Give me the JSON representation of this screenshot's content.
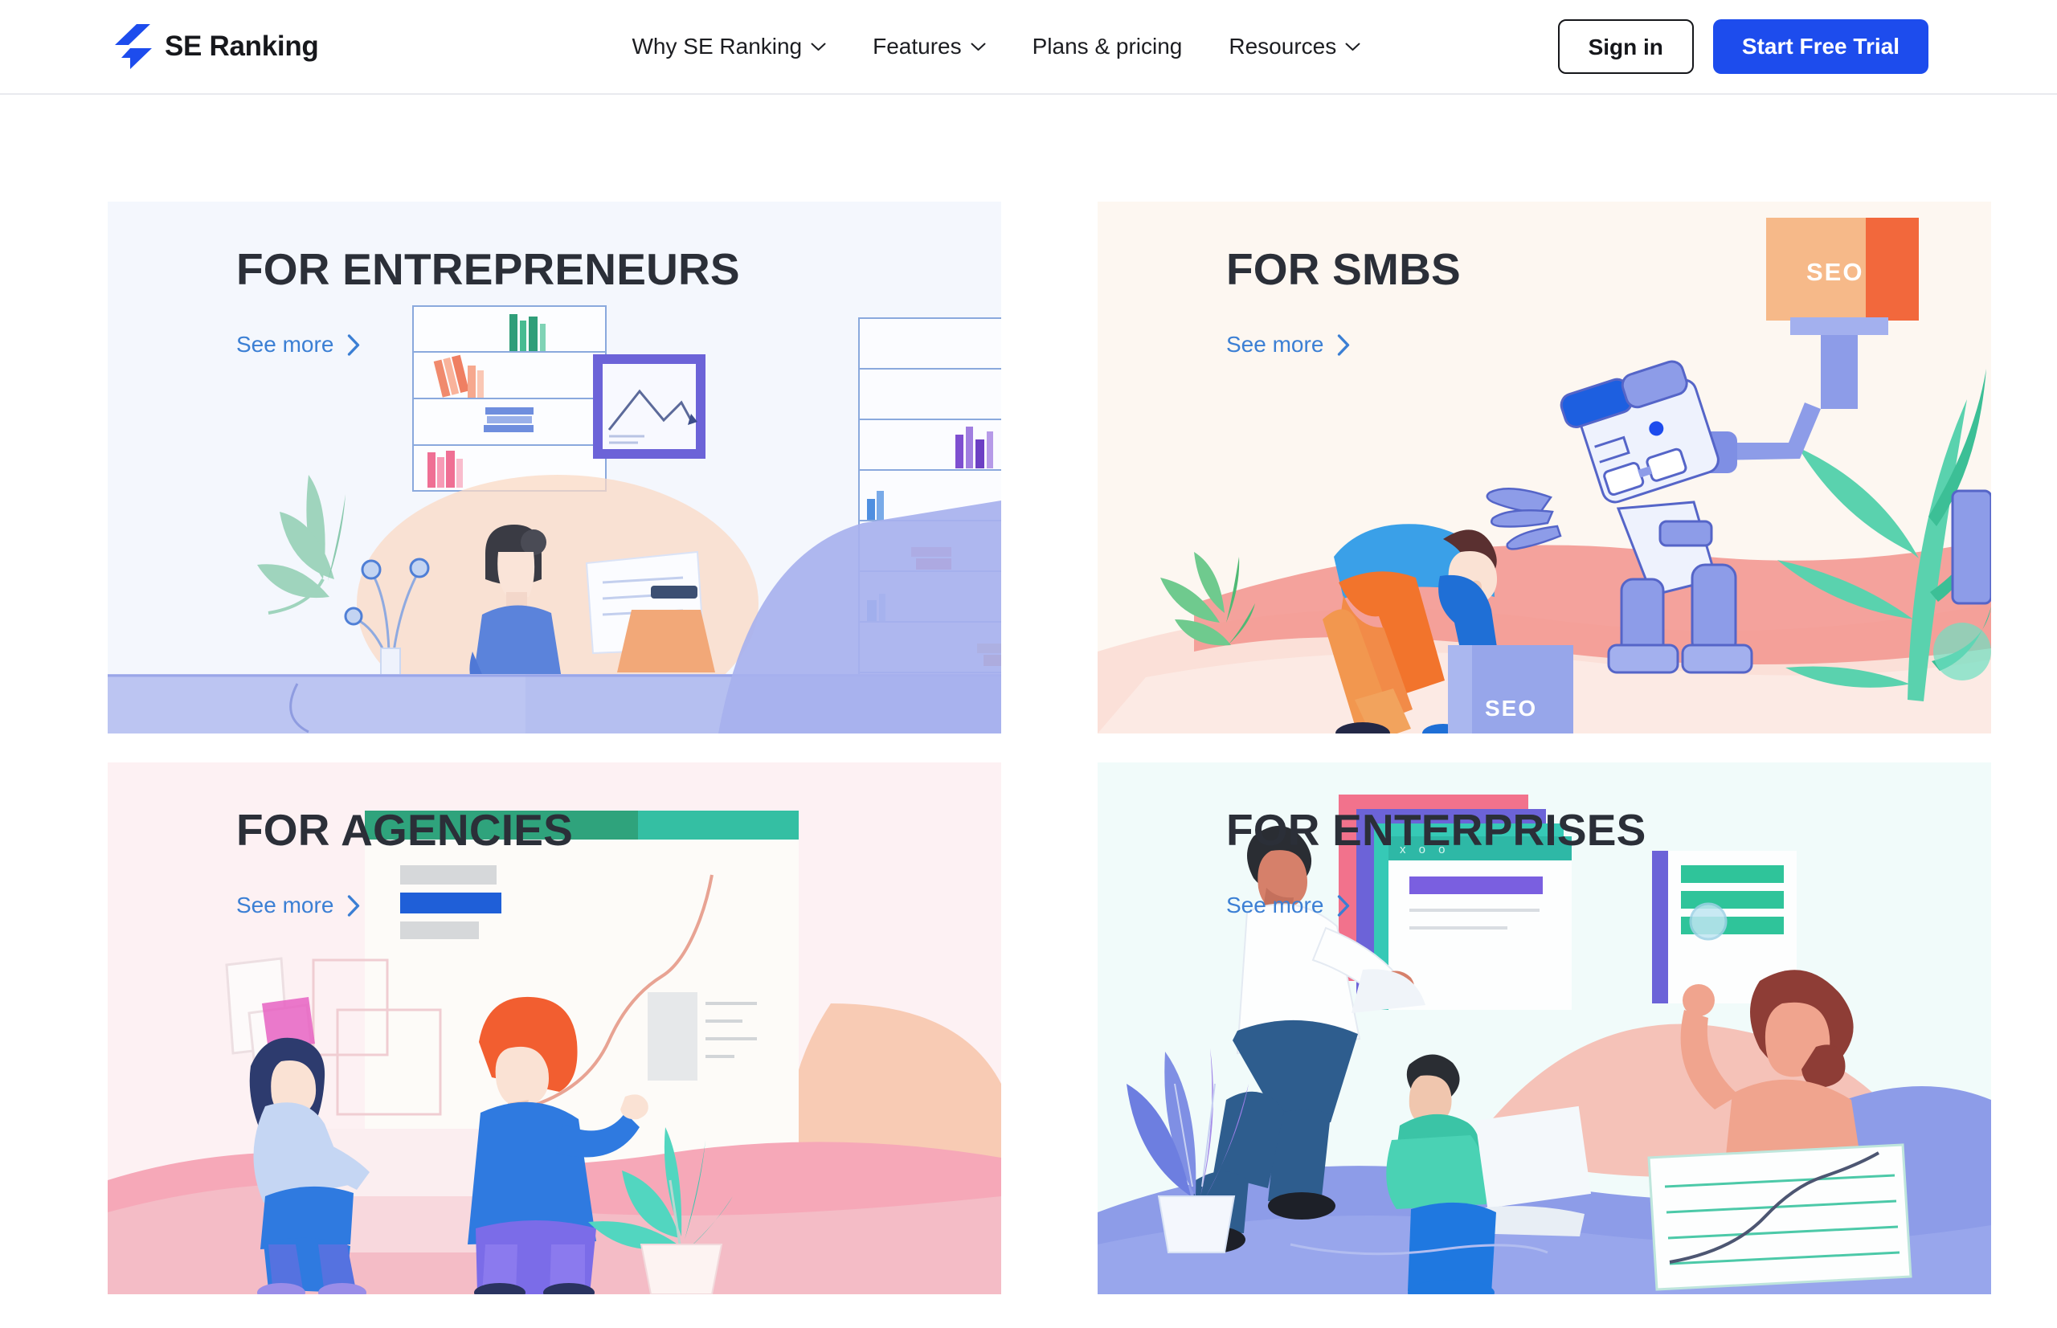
{
  "header": {
    "logo": {
      "icon": "lightning-bolt-icon",
      "text": "SE Ranking",
      "color": "#1d4ced"
    },
    "nav": [
      {
        "label": "Why SE Ranking",
        "has_dropdown": true,
        "icon": "chevron-down-icon"
      },
      {
        "label": "Features",
        "has_dropdown": true,
        "icon": "chevron-down-icon"
      },
      {
        "label": "Plans & pricing",
        "has_dropdown": false
      },
      {
        "label": "Resources",
        "has_dropdown": true,
        "icon": "chevron-down-icon"
      }
    ],
    "sign_in_label": "Sign in",
    "start_trial_label": "Start Free Trial",
    "accent_color": "#1d4ced"
  },
  "cards": [
    {
      "title": "FOR ENTREPRENEURS",
      "link_label": "See more",
      "link_icon": "chevron-right-icon",
      "background": "#f4f7fd",
      "accent_color": "#4f63d8",
      "illustration": "entrepreneur-at-desk-with-bookshelves-illustration"
    },
    {
      "title": "FOR SMBS",
      "link_label": "See more",
      "link_icon": "chevron-right-icon",
      "background": "#fdf7f1",
      "accent_color": "#f5a73c",
      "illustration": "robot-holding-seo-sign-with-person-lifting-seo-box-illustration",
      "sign_label": "SEO",
      "box_label": "SEO"
    },
    {
      "title": "FOR AGENCIES",
      "link_label": "See more",
      "link_icon": "chevron-right-icon",
      "background": "#fdf1f3",
      "accent_color": "#ef8f8f",
      "illustration": "two-people-presenting-growth-chart-board-illustration"
    },
    {
      "title": "FOR ENTERPRISES",
      "link_label": "See more",
      "link_icon": "chevron-right-icon",
      "background": "#f1fbfa",
      "accent_color": "#2bc4bb",
      "illustration": "team-analyzing-browser-windows-and-report-illustration",
      "window_controls": "x o o"
    }
  ]
}
